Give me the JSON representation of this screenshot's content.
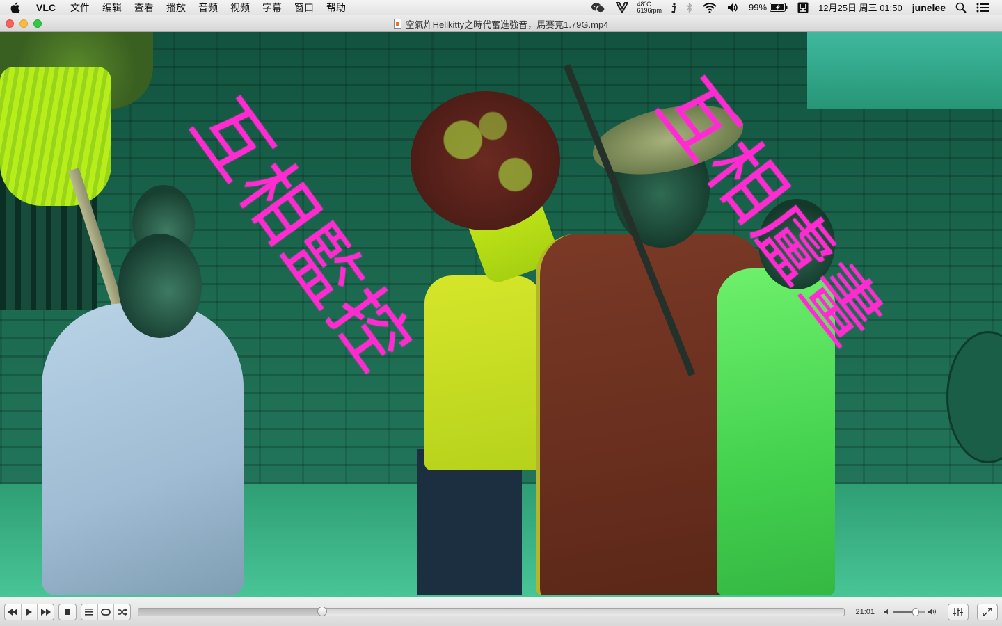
{
  "menubar": {
    "app_name": "VLC",
    "menus": [
      "文件",
      "编辑",
      "查看",
      "播放",
      "音频",
      "视频",
      "字幕",
      "窗口",
      "帮助"
    ],
    "status": {
      "temperature": "48°C",
      "fan_speed": "6196rpm",
      "battery_percent": "99%",
      "datetime": "12月25日 周三  01:50",
      "username": "junelee"
    },
    "icons": [
      "apple-icon",
      "wechat-icon",
      "vivaldi-icon",
      "info-icon",
      "bluetooth-icon",
      "wifi-icon",
      "volume-icon",
      "battery-icon",
      "keyboard-input-icon",
      "spotlight-icon",
      "notification-center-icon"
    ]
  },
  "window": {
    "title": "空氣炸Hellkitty之時代奮進強音，馬賽克1.79G.mp4"
  },
  "video": {
    "overlay_left": "互相監控",
    "overlay_right": "互相盧畫",
    "accent_color": "#ff2bd0"
  },
  "controls": {
    "elapsed": "21:01",
    "progress_fraction": 0.26,
    "volume_fraction": 0.7,
    "buttons": [
      "rewind-button",
      "play-button",
      "fast-forward-button",
      "stop-button",
      "playlist-button",
      "loop-button",
      "shuffle-button",
      "equalizer-button",
      "fullscreen-button"
    ]
  }
}
